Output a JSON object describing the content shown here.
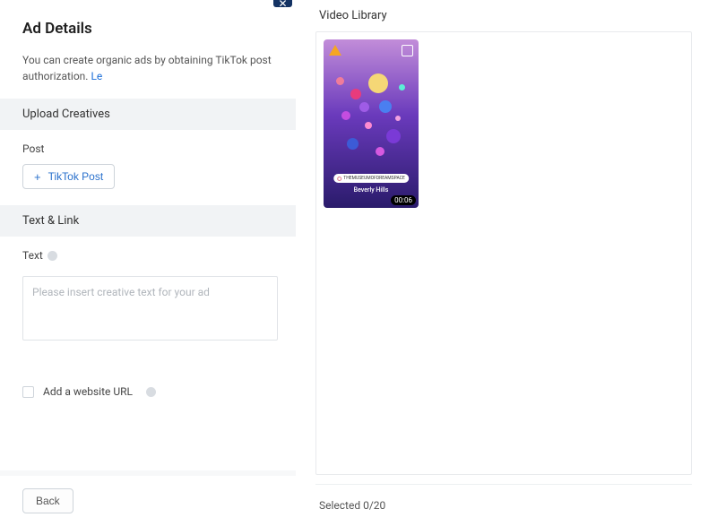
{
  "left": {
    "title": "Ad Details",
    "subtitle_text": "You can create organic ads by obtaining TikTok post authorization. ",
    "subtitle_link": "Le",
    "sections": {
      "upload": "Upload Creatives",
      "text_link": "Text & Link"
    },
    "post": {
      "label": "Post",
      "button": "TikTok Post"
    },
    "text_field": {
      "label": "Text",
      "placeholder": "Please insert creative text for your ad"
    },
    "add_url": "Add a website URL",
    "back": "Back"
  },
  "right": {
    "title": "Video Library",
    "selected": "Selected 0/20"
  },
  "video": {
    "tag": "THEMUSEUMOFDREAMSPACE",
    "location": "Beverly Hills",
    "duration": "00:06"
  }
}
